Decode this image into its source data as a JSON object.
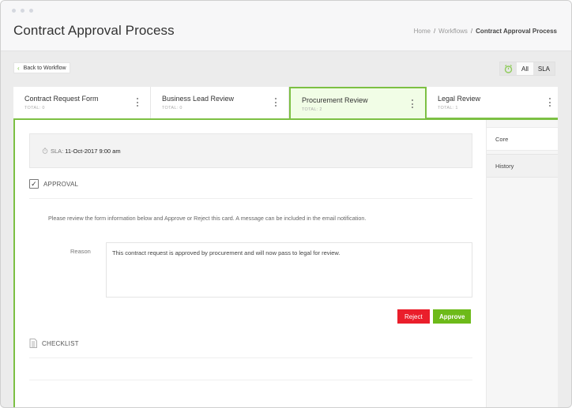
{
  "window": {
    "title": "Contract Approval Process"
  },
  "breadcrumb": {
    "items": [
      "Home",
      "Workflows",
      "Contract Approval Process"
    ],
    "separator": "/"
  },
  "toolbar": {
    "back_label": "Back to Workflow",
    "back_icon": "chevron-left-icon",
    "filter": {
      "timer_icon": "stopwatch-icon",
      "options": [
        "All",
        "SLA"
      ],
      "selected": "All"
    }
  },
  "stages": [
    {
      "title": "Contract Request Form",
      "total": "TOTAL: 0",
      "active": false
    },
    {
      "title": "Business Lead Review",
      "total": "TOTAL: 0",
      "active": false
    },
    {
      "title": "Procurement Review",
      "total": "TOTAL: 2",
      "active": true
    },
    {
      "title": "Legal Review",
      "total": "TOTAL: 1",
      "active": false
    }
  ],
  "card": {
    "sla": {
      "label": "SLA:",
      "value": "11-Oct-2017 9:00 am"
    },
    "approval": {
      "heading": "APPROVAL",
      "instructions": "Please review the form information below and Approve or Reject this card. A message can be included in the email notification.",
      "reason_label": "Reason",
      "reason_value": "This contract request is approved by procurement and will now pass to legal for review.",
      "reject_label": "Reject",
      "approve_label": "Approve"
    },
    "checklist": {
      "heading": "CHECKLIST"
    }
  },
  "side_tabs": [
    {
      "label": "Core",
      "active": true
    },
    {
      "label": "History",
      "active": false
    }
  ],
  "colors": {
    "accent_green": "#7cc043",
    "approve_green": "#6dba19",
    "reject_red": "#ea1e2b",
    "active_tab_bg": "#f1fde6"
  }
}
